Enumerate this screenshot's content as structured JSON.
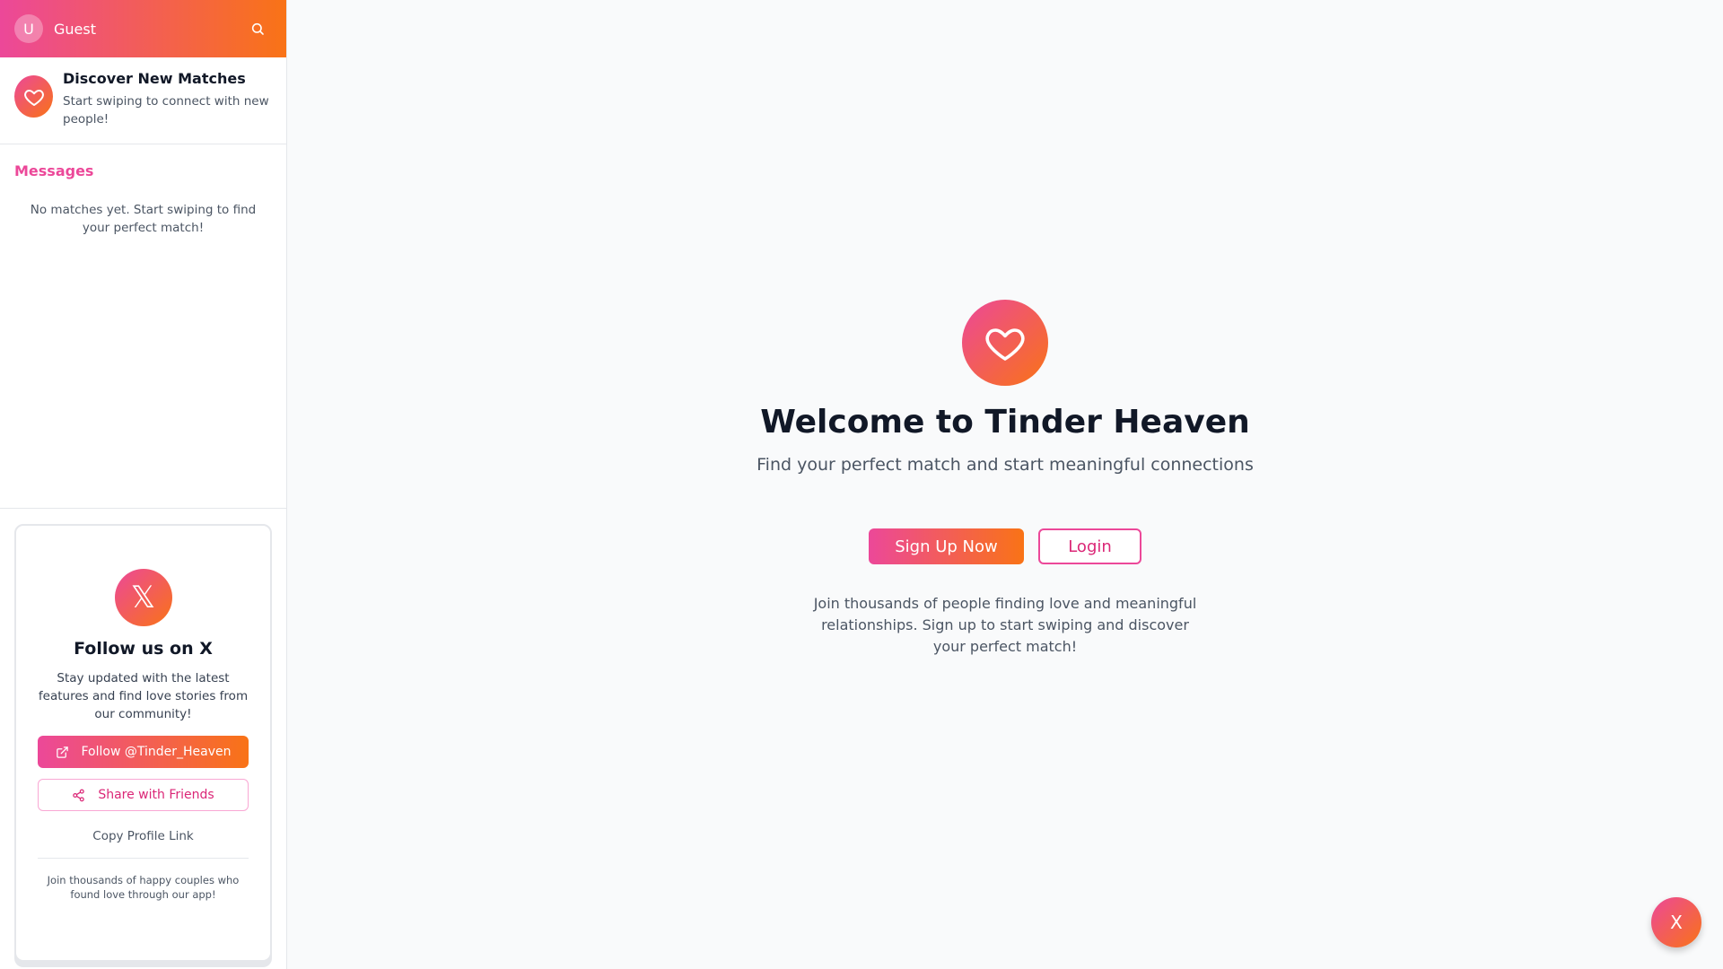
{
  "colors": {
    "accent_start": "#ec4899",
    "accent_end": "#f97316"
  },
  "sidebar": {
    "user": {
      "avatar_initial": "U",
      "name": "Guest"
    },
    "search_icon": "search-icon",
    "discover": {
      "icon": "heart-icon",
      "title": "Discover New Matches",
      "subtitle": "Start swiping to connect with new people!"
    },
    "messages": {
      "title": "Messages",
      "empty_text": "No matches yet. Start swiping to find your perfect match!"
    },
    "follow_card": {
      "badge": "𝕏",
      "title": "Follow us on X",
      "description": "Stay updated with the latest features and find love stories from our community!",
      "follow_label": "Follow @Tinder_Heaven",
      "share_label": "Share with Friends",
      "copy_label": "Copy Profile Link",
      "footer_text": "Join thousands of happy couples who found love through our app!"
    }
  },
  "main": {
    "icon": "heart-icon",
    "title": "Welcome to Tinder Heaven",
    "subtitle": "Find your perfect match and start meaningful connections",
    "signup_label": "Sign Up Now",
    "login_label": "Login",
    "join_text": "Join thousands of people finding love and meaningful relationships. Sign up to start swiping and discover your perfect match!"
  },
  "fab": {
    "label": "X",
    "icon": "close-icon"
  }
}
